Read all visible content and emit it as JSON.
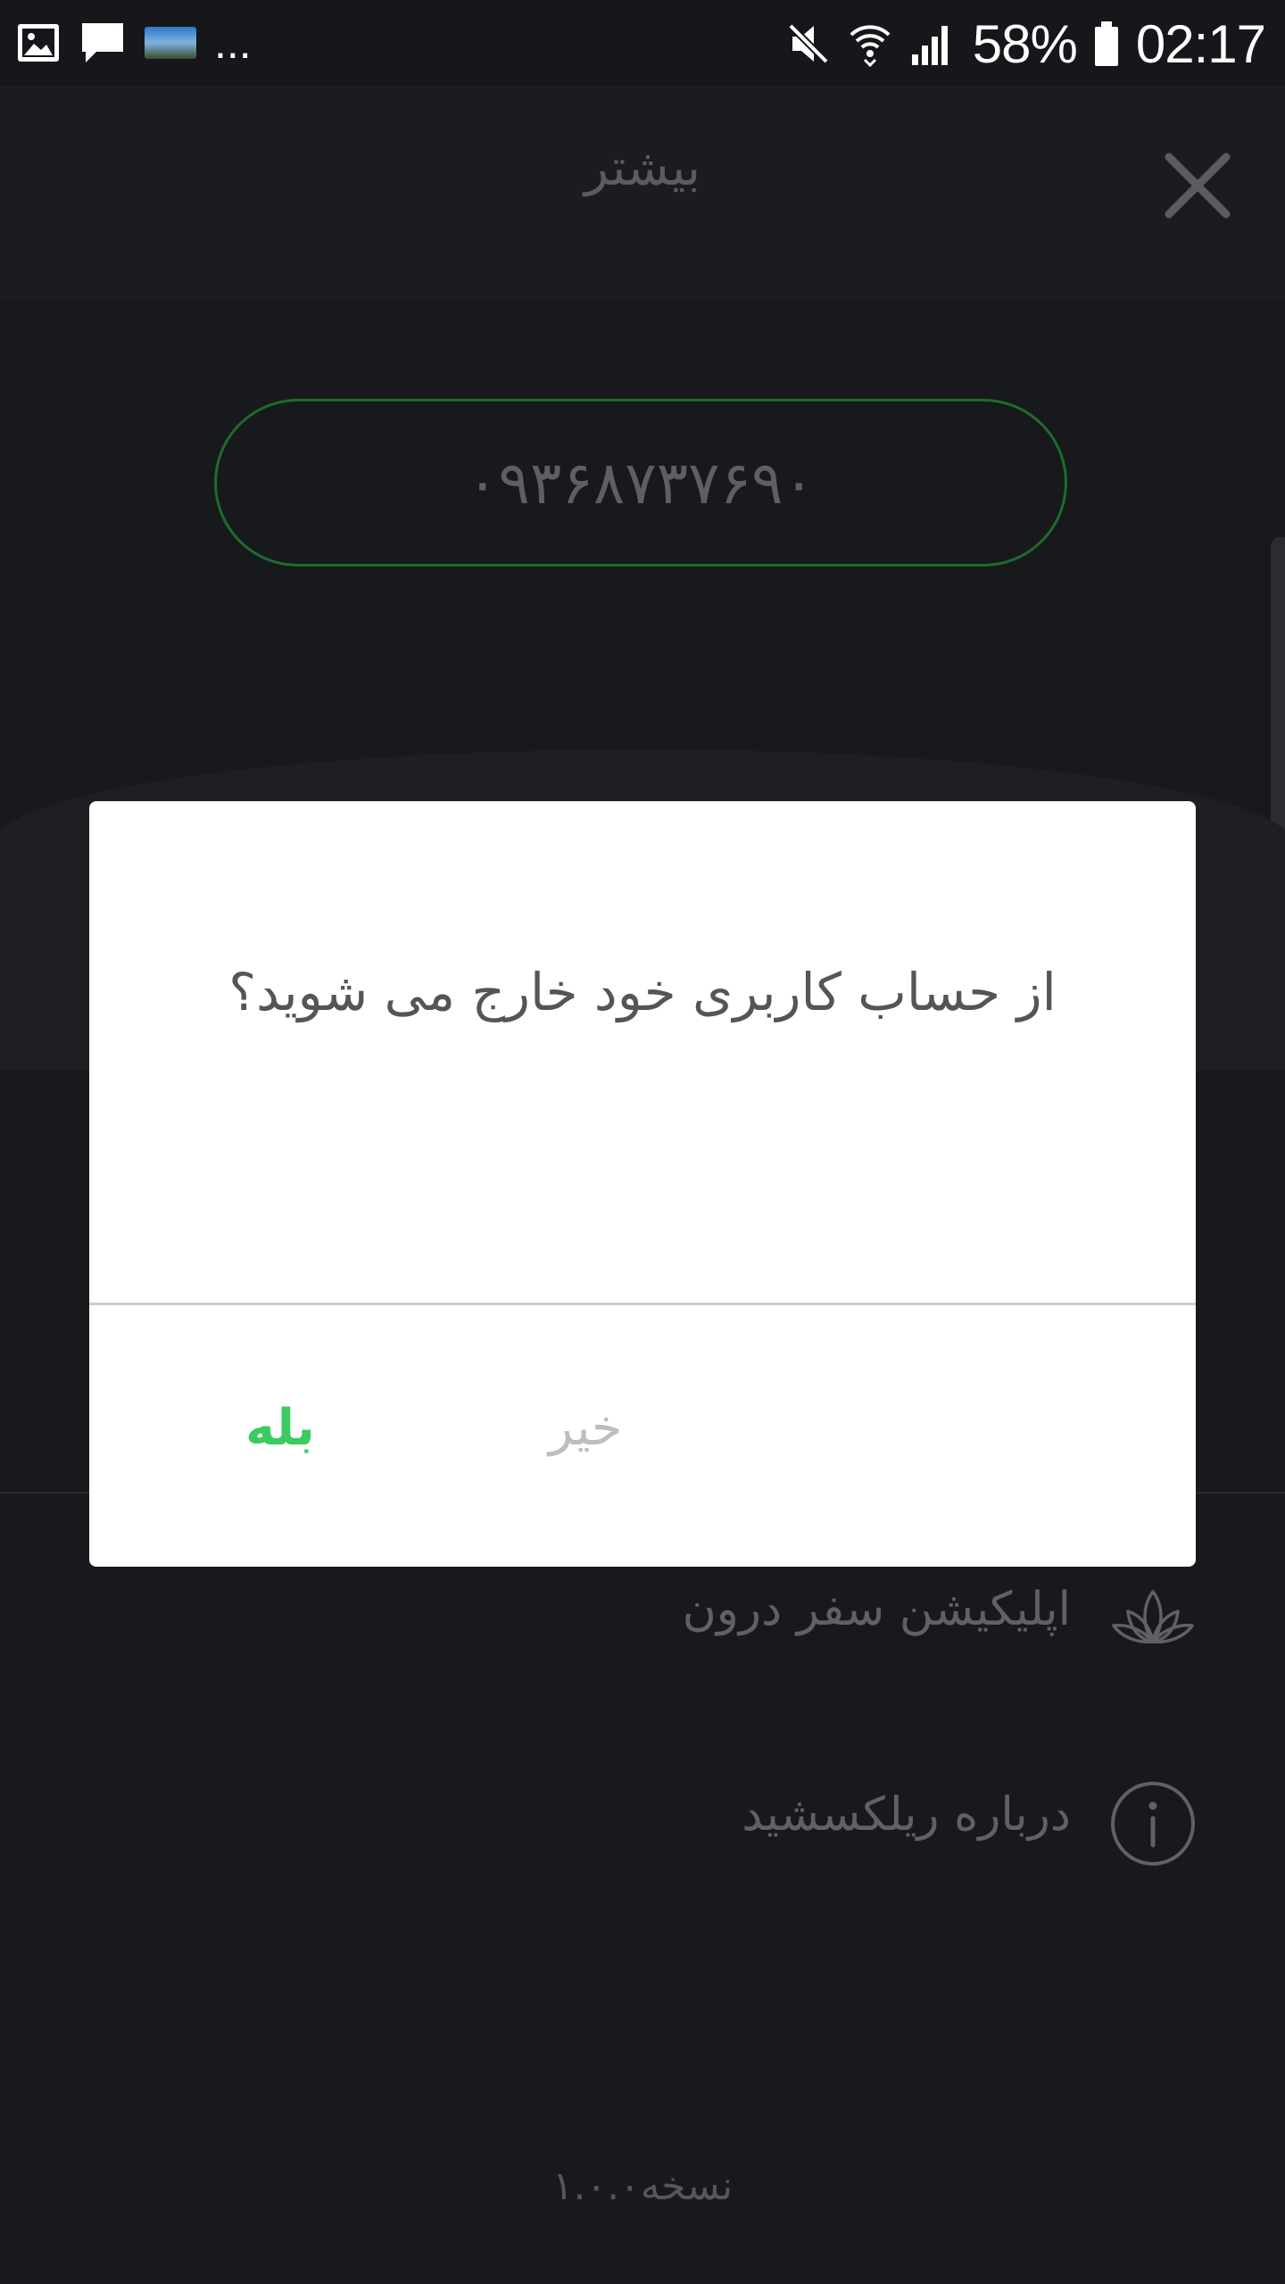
{
  "status_bar": {
    "battery": "58%",
    "time": "02:17",
    "icons": [
      "gallery-icon",
      "message-icon",
      "app-thumbnail-icon",
      "more-dots-icon",
      "mute-icon",
      "wifi-icon",
      "signal-icon",
      "battery-icon"
    ],
    "more": "..."
  },
  "header": {
    "title": "بیشتر",
    "close_icon": "close-icon"
  },
  "account": {
    "phone": "۰۹۳۶۸۷۳۷۶۹۰"
  },
  "menu": {
    "items": [
      {
        "label": "اپلیکیشن سفر درون",
        "icon": "lotus-icon"
      },
      {
        "label": "درباره ریلکسشید",
        "icon": "info-icon"
      }
    ]
  },
  "footer": {
    "version": "نسخه۱.۰.۰"
  },
  "dialog": {
    "message": "از حساب کاربری خود خارج می شوید؟",
    "yes_label": "بله",
    "no_label": "خیر"
  },
  "colors": {
    "accent_green": "#3ccb5e",
    "pill_border": "#1f6b2c",
    "background": "#17191d"
  }
}
